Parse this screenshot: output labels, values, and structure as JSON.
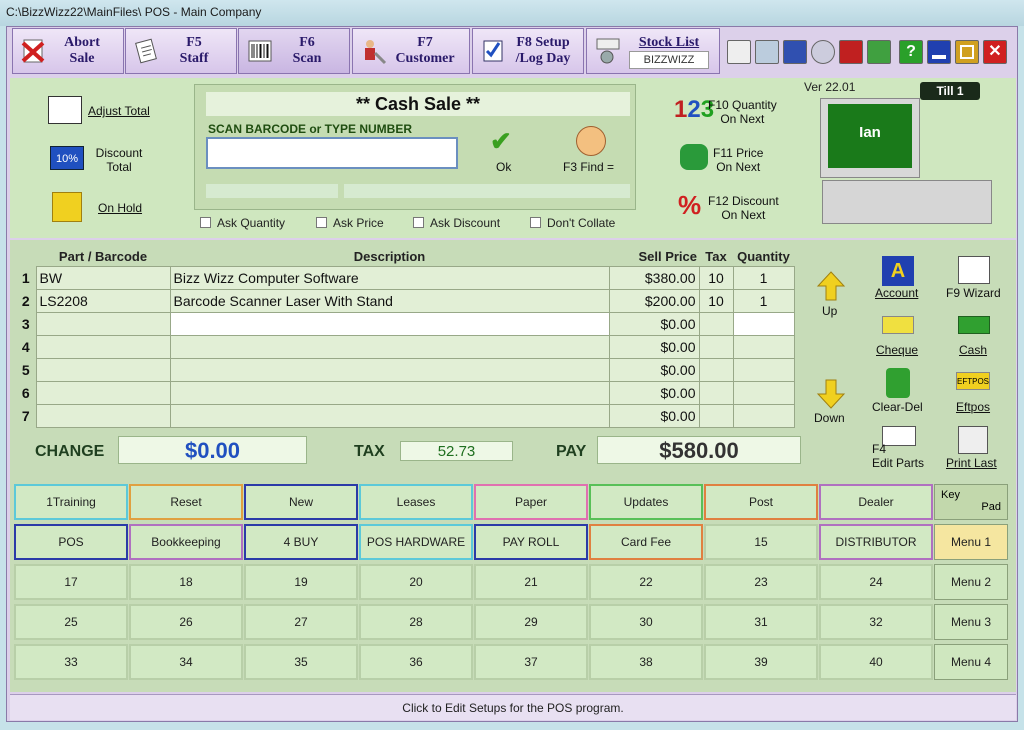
{
  "window": {
    "title": "C:\\BizzWizz22\\MainFiles\\ POS - Main Company"
  },
  "toolbar": [
    {
      "line1": "Abort",
      "line2": "Sale",
      "icon": "abort-icon"
    },
    {
      "line1": "F5",
      "line2": "Staff",
      "icon": "staff-icon"
    },
    {
      "line1": "F6",
      "line2": "Scan",
      "icon": "barcode-icon"
    },
    {
      "line1": "F7",
      "line2": "Customer",
      "icon": "customer-icon"
    },
    {
      "line1": "F8 Setup",
      "line2": "/Log Day",
      "icon": "setup-icon"
    },
    {
      "line1": "Stock List",
      "line2": "BIZZWIZZ",
      "icon": "stock-icon"
    }
  ],
  "version": "Ver 22.01",
  "till": "Till 1",
  "operator": "Ian",
  "left_actions": {
    "adjust": "Adjust Total",
    "discount": "Discount\nTotal",
    "hold": "On Hold"
  },
  "sale": {
    "title": "** Cash Sale **",
    "prompt": "SCAN BARCODE  or TYPE NUMBER",
    "barcode_value": "",
    "ok": "Ok",
    "find": "F3 Find  ="
  },
  "options": [
    "Ask Quantity",
    "Ask Price",
    "Ask Discount",
    "Don't Collate"
  ],
  "fkeys": [
    {
      "line1": "F10 Quantity",
      "line2": "On Next"
    },
    {
      "line1": "F11  Price",
      "line2": "On Next"
    },
    {
      "line1": "F12 Discount",
      "line2": "On Next"
    }
  ],
  "grid": {
    "headers": [
      "Part / Barcode",
      "Description",
      "Sell Price",
      "Tax",
      "Quantity"
    ],
    "rows": [
      {
        "n": "1",
        "part": "BW",
        "desc": "Bizz Wizz Computer Software",
        "price": "$380.00",
        "tax": "10",
        "qty": "1"
      },
      {
        "n": "2",
        "part": "LS2208",
        "desc": "Barcode Scanner Laser With Stand",
        "price": "$200.00",
        "tax": "10",
        "qty": "1"
      },
      {
        "n": "3",
        "part": "",
        "desc": "",
        "price": "$0.00",
        "tax": "",
        "qty": ""
      },
      {
        "n": "4",
        "part": "",
        "desc": "",
        "price": "$0.00",
        "tax": "",
        "qty": ""
      },
      {
        "n": "5",
        "part": "",
        "desc": "",
        "price": "$0.00",
        "tax": "",
        "qty": ""
      },
      {
        "n": "6",
        "part": "",
        "desc": "",
        "price": "$0.00",
        "tax": "",
        "qty": ""
      },
      {
        "n": "7",
        "part": "",
        "desc": "",
        "price": "$0.00",
        "tax": "",
        "qty": ""
      }
    ]
  },
  "nav": {
    "up": "Up",
    "down": "Down"
  },
  "payment": {
    "account": "Account",
    "wizard": "F9 Wizard",
    "cheque": "Cheque",
    "cash": "Cash",
    "clear": "Clear-Del",
    "eftpos": "Eftpos",
    "edit1": "F4",
    "edit2": "Edit Parts",
    "print": "Print Last"
  },
  "totals": {
    "change_label": "CHANGE",
    "change": "$0.00",
    "tax_label": "TAX",
    "tax": "52.73",
    "pay_label": "PAY",
    "pay": "$580.00"
  },
  "shortcuts": [
    [
      {
        "t": "1Training",
        "c": "#5cc9d9"
      },
      {
        "t": "Reset",
        "c": "#e0a040"
      },
      {
        "t": "New",
        "c": "#2b3aa8"
      },
      {
        "t": "Leases",
        "c": "#5cc9d9"
      },
      {
        "t": "Paper",
        "c": "#e070b0"
      },
      {
        "t": "Updates",
        "c": "#58c058"
      },
      {
        "t": "Post",
        "c": "#e08040"
      },
      {
        "t": "Dealer",
        "c": "#b070c0"
      }
    ],
    [
      {
        "t": "POS",
        "c": "#2b3aa8"
      },
      {
        "t": "Bookkeeping",
        "c": "#b070c0"
      },
      {
        "t": "4 BUY",
        "c": "#2b3aa8"
      },
      {
        "t": "POS HARDWARE",
        "c": "#5cc9d9"
      },
      {
        "t": "PAY ROLL",
        "c": "#2b3aa8"
      },
      {
        "t": "Card Fee",
        "c": "#e08040"
      },
      {
        "t": "15",
        "c": ""
      },
      {
        "t": "DISTRIBUTOR",
        "c": "#b070c0"
      }
    ],
    [
      {
        "t": "17"
      },
      {
        "t": "18"
      },
      {
        "t": "19"
      },
      {
        "t": "20"
      },
      {
        "t": "21"
      },
      {
        "t": "22"
      },
      {
        "t": "23"
      },
      {
        "t": "24"
      }
    ],
    [
      {
        "t": "25"
      },
      {
        "t": "26"
      },
      {
        "t": "27"
      },
      {
        "t": "28"
      },
      {
        "t": "29"
      },
      {
        "t": "30"
      },
      {
        "t": "31"
      },
      {
        "t": "32"
      }
    ],
    [
      {
        "t": "33"
      },
      {
        "t": "34"
      },
      {
        "t": "35"
      },
      {
        "t": "36"
      },
      {
        "t": "37"
      },
      {
        "t": "38"
      },
      {
        "t": "39"
      },
      {
        "t": "40"
      }
    ]
  ],
  "keypad": {
    "line1": "Key",
    "line2": "Pad"
  },
  "menus": [
    "Menu 1",
    "Menu 2",
    "Menu 3",
    "Menu 4"
  ],
  "status": "Click to Edit Setups for the POS program."
}
